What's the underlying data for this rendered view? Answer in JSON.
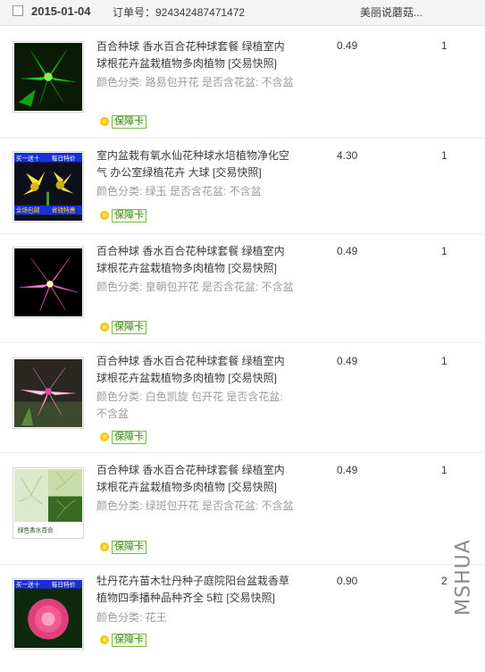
{
  "header": {
    "date": "2015-01-04",
    "order_label": "订单号：924342487471472",
    "shop_name": "美丽说蘑菇..."
  },
  "items": [
    {
      "title": "百合种球 香水百合花种球套餐 绿植室内球根花卉盆栽植物多肉植物 [交易快照]",
      "meta": "颜色分类: 路易包开花  是否含花盆: 不含盆",
      "price": "0.49",
      "qty": "1",
      "badge": "保障卡"
    },
    {
      "title": "室内盆栽有氧水仙花种球水培植物净化空气 办公室绿植花卉 大球 [交易快照]",
      "meta": "颜色分类: 绿玉  是否含花盆: 不含盆",
      "price": "4.30",
      "qty": "1",
      "badge": "保障卡",
      "thumb_overlay": [
        "买一送十",
        "每日特价",
        "全场包邮",
        "省钱特惠"
      ]
    },
    {
      "title": "百合种球 香水百合花种球套餐 绿植室内球根花卉盆栽植物多肉植物 [交易快照]",
      "meta": "颜色分类: 皇朝包开花  是否含花盆: 不含盆",
      "price": "0.49",
      "qty": "1",
      "badge": "保障卡"
    },
    {
      "title": "百合种球 香水百合花种球套餐 绿植室内球根花卉盆栽植物多肉植物 [交易快照]",
      "meta": "颜色分类: 白色凯旋 包开花  是否含花盆: 不含盆",
      "price": "0.49",
      "qty": "1",
      "badge": "保障卡"
    },
    {
      "title": "百合种球 香水百合花种球套餐 绿植室内球根花卉盆栽植物多肉植物 [交易快照]",
      "meta": "颜色分类: 绿斑包开花  是否含花盆: 不含盆",
      "price": "0.49",
      "qty": "1",
      "badge": "保障卡",
      "thumb_caption": "绿色香水百合"
    },
    {
      "title": "牡丹花卉苗木牡丹种子庭院阳台盆栽香草植物四季播种品种齐全 5粒 [交易快照]",
      "meta": "颜色分类: 花王",
      "price": "0.90",
      "qty": "2",
      "badge": "保障卡",
      "thumb_overlay": [
        "买一送十",
        "每日特价"
      ]
    }
  ],
  "watermark": "MSHUA",
  "colors": {
    "header_bg": "#f4f4f4",
    "badge_green": "#3d8a1c",
    "meta_gray": "#9c9c9c"
  }
}
